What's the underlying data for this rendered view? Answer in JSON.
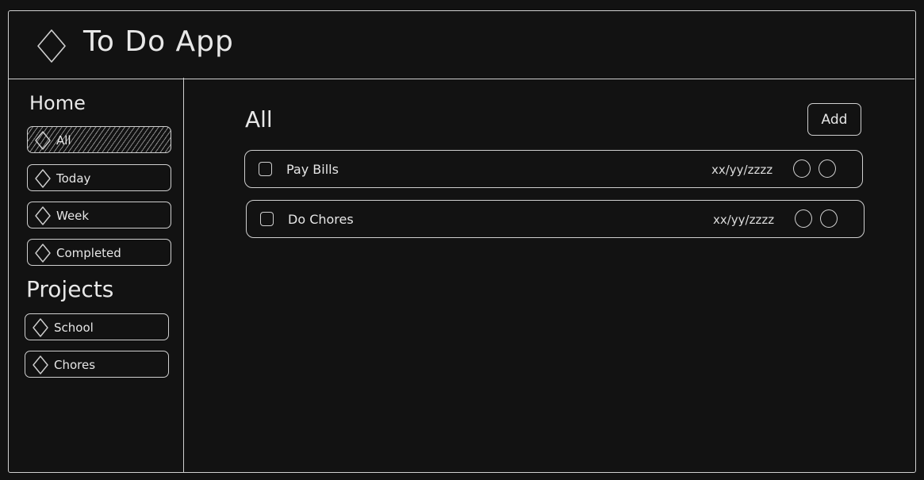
{
  "header": {
    "title": "To Do App",
    "logo_icon": "diamond-icon"
  },
  "sidebar": {
    "home_title": "Home",
    "home_items": [
      {
        "label": "All",
        "icon": "diamond-icon",
        "active": true
      },
      {
        "label": "Today",
        "icon": "diamond-icon",
        "active": false
      },
      {
        "label": "Week",
        "icon": "diamond-icon",
        "active": false
      },
      {
        "label": "Completed",
        "icon": "diamond-icon",
        "active": false
      }
    ],
    "projects_title": "Projects",
    "project_items": [
      {
        "label": "School",
        "icon": "diamond-icon"
      },
      {
        "label": "Chores",
        "icon": "diamond-icon"
      }
    ]
  },
  "main": {
    "title": "All",
    "add_label": "Add",
    "tasks": [
      {
        "title": "Pay Bills",
        "date": "xx/yy/zzzz",
        "checked": false
      },
      {
        "title": "Do Chores",
        "date": "xx/yy/zzzz",
        "checked": false
      }
    ]
  },
  "colors": {
    "background": "#121212",
    "stroke": "#cfcfcf",
    "text": "#e6e6e6"
  }
}
